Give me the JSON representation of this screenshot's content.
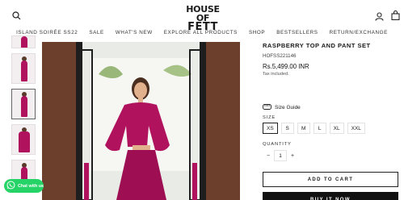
{
  "header": {
    "logo_line1": "HOUSE OF",
    "logo_line2": "FETT",
    "icons": [
      "search-icon",
      "user-icon",
      "cart-icon"
    ]
  },
  "nav": {
    "items": [
      "ISLAND SOIRÉE SS22",
      "SALE",
      "WHAT'S NEW",
      "EXPLORE ALL PRODUCTS",
      "SHOP",
      "BESTSELLERS",
      "RETURN/EXCHANGE"
    ]
  },
  "product": {
    "title": "RASPBERRY TOP AND PANT SET",
    "sku": "HOFSS221146",
    "price": "Rs.5,499.00 INR",
    "tax_note": "Tax included.",
    "size_guide_label": "Size Guide",
    "size_label": "SIZE",
    "sizes": [
      "XS",
      "S",
      "M",
      "L",
      "XL",
      "XXL"
    ],
    "selected_size": "XS",
    "quantity_label": "QUANTITY",
    "quantity": "1",
    "add_to_cart_label": "ADD TO CART",
    "buy_now_label": "BUY IT NOW"
  },
  "chat": {
    "label": "Chat with us"
  },
  "colors": {
    "accent": "#b0125e",
    "whatsapp": "#25d366",
    "dark": "#111111"
  }
}
